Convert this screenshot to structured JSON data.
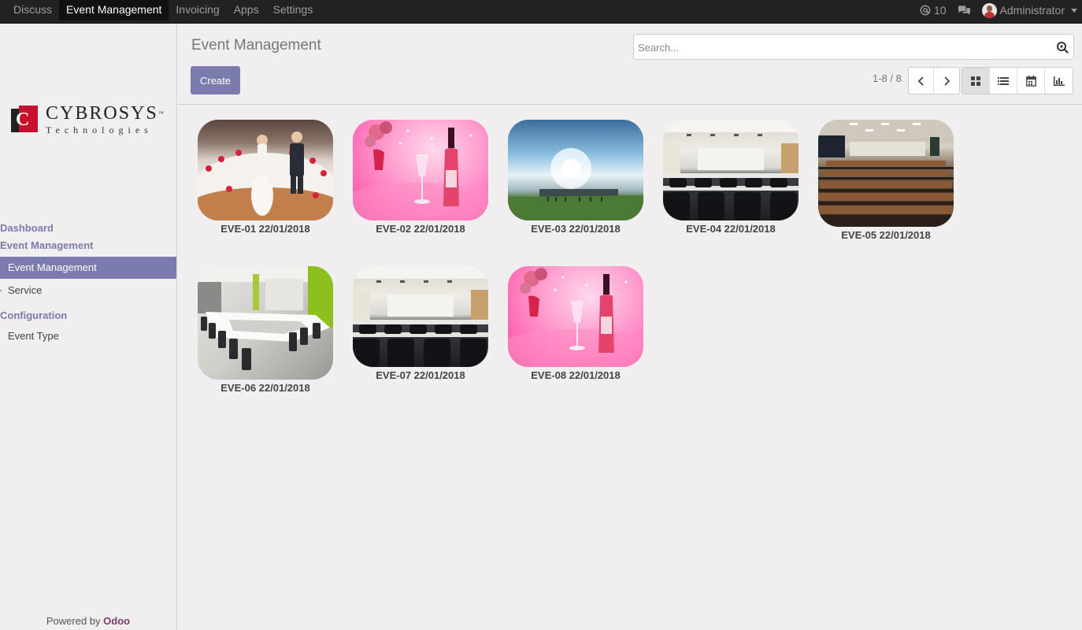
{
  "topbar": {
    "menu": [
      "Discuss",
      "Event Management",
      "Invoicing",
      "Apps",
      "Settings"
    ],
    "active_index": 1,
    "notification_count": "10",
    "user_name": "Administrator"
  },
  "sidebar": {
    "logo_name": "CYBROSYS",
    "logo_sub": "Technologies",
    "sections": {
      "dashboard": "Dashboard",
      "event_management": "Event Management",
      "configuration": "Configuration"
    },
    "items": {
      "event_management": "Event Management",
      "service": "Service",
      "event_type": "Event Type"
    },
    "powered_prefix": "Powered by ",
    "powered_brand": "Odoo"
  },
  "header": {
    "title": "Event Management",
    "create_label": "Create",
    "search_placeholder": "Search...",
    "pager": "1-8 / 8"
  },
  "events": [
    {
      "label": "EVE-01 22/01/2018",
      "image": "wedding-cake"
    },
    {
      "label": "EVE-02 22/01/2018",
      "image": "pink-wine"
    },
    {
      "label": "EVE-03 22/01/2018",
      "image": "field-sky"
    },
    {
      "label": "EVE-04 22/01/2018",
      "image": "conference-hall"
    },
    {
      "label": "EVE-05 22/01/2018",
      "image": "auditorium"
    },
    {
      "label": "EVE-06 22/01/2018",
      "image": "meeting-room"
    },
    {
      "label": "EVE-07 22/01/2018",
      "image": "conference-hall"
    },
    {
      "label": "EVE-08 22/01/2018",
      "image": "pink-wine"
    }
  ],
  "colors": {
    "accent": "#7c7bad",
    "navbar": "#222222",
    "background": "#f0eeee"
  }
}
